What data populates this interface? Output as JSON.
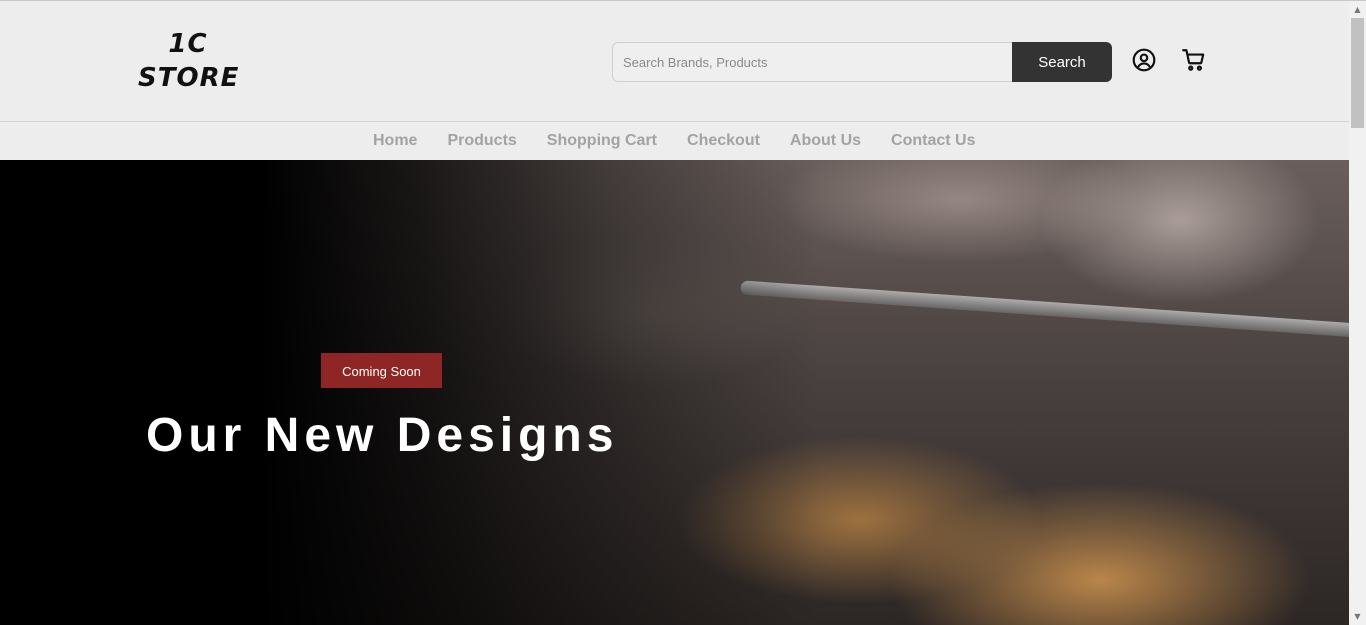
{
  "logo": {
    "line1": "1C",
    "line2": "STORE"
  },
  "search": {
    "placeholder": "Search Brands, Products",
    "value": "",
    "button_label": "Search"
  },
  "header_icons": {
    "user": "user-circle-icon",
    "cart": "shopping-cart-icon"
  },
  "nav": {
    "items": [
      {
        "label": "Home"
      },
      {
        "label": "Products"
      },
      {
        "label": "Shopping Cart"
      },
      {
        "label": "Checkout"
      },
      {
        "label": "About Us"
      },
      {
        "label": "Contact Us"
      }
    ]
  },
  "hero": {
    "badge": "Coming Soon",
    "title": "Our New Designs"
  },
  "colors": {
    "badge": "#8f2626",
    "search_button": "#333333",
    "nav_text": "#a3a3a3",
    "header_bg": "#ededed"
  },
  "scrollbar": {
    "up_icon": "scroll-up-arrow-icon",
    "down_icon": "scroll-down-arrow-icon"
  }
}
